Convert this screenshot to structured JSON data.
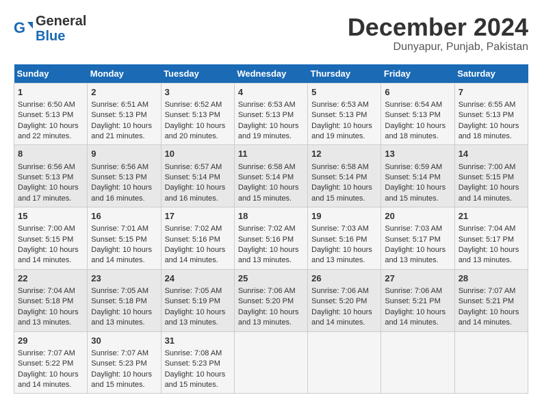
{
  "header": {
    "logo_line1": "General",
    "logo_line2": "Blue",
    "month": "December 2024",
    "location": "Dunyapur, Punjab, Pakistan"
  },
  "days_of_week": [
    "Sunday",
    "Monday",
    "Tuesday",
    "Wednesday",
    "Thursday",
    "Friday",
    "Saturday"
  ],
  "weeks": [
    [
      {
        "day": 1,
        "sunrise": "6:50 AM",
        "sunset": "5:13 PM",
        "daylight": "10 hours and 22 minutes."
      },
      {
        "day": 2,
        "sunrise": "6:51 AM",
        "sunset": "5:13 PM",
        "daylight": "10 hours and 21 minutes."
      },
      {
        "day": 3,
        "sunrise": "6:52 AM",
        "sunset": "5:13 PM",
        "daylight": "10 hours and 20 minutes."
      },
      {
        "day": 4,
        "sunrise": "6:53 AM",
        "sunset": "5:13 PM",
        "daylight": "10 hours and 19 minutes."
      },
      {
        "day": 5,
        "sunrise": "6:53 AM",
        "sunset": "5:13 PM",
        "daylight": "10 hours and 19 minutes."
      },
      {
        "day": 6,
        "sunrise": "6:54 AM",
        "sunset": "5:13 PM",
        "daylight": "10 hours and 18 minutes."
      },
      {
        "day": 7,
        "sunrise": "6:55 AM",
        "sunset": "5:13 PM",
        "daylight": "10 hours and 18 minutes."
      }
    ],
    [
      {
        "day": 8,
        "sunrise": "6:56 AM",
        "sunset": "5:13 PM",
        "daylight": "10 hours and 17 minutes."
      },
      {
        "day": 9,
        "sunrise": "6:56 AM",
        "sunset": "5:13 PM",
        "daylight": "10 hours and 16 minutes."
      },
      {
        "day": 10,
        "sunrise": "6:57 AM",
        "sunset": "5:14 PM",
        "daylight": "10 hours and 16 minutes."
      },
      {
        "day": 11,
        "sunrise": "6:58 AM",
        "sunset": "5:14 PM",
        "daylight": "10 hours and 15 minutes."
      },
      {
        "day": 12,
        "sunrise": "6:58 AM",
        "sunset": "5:14 PM",
        "daylight": "10 hours and 15 minutes."
      },
      {
        "day": 13,
        "sunrise": "6:59 AM",
        "sunset": "5:14 PM",
        "daylight": "10 hours and 15 minutes."
      },
      {
        "day": 14,
        "sunrise": "7:00 AM",
        "sunset": "5:15 PM",
        "daylight": "10 hours and 14 minutes."
      }
    ],
    [
      {
        "day": 15,
        "sunrise": "7:00 AM",
        "sunset": "5:15 PM",
        "daylight": "10 hours and 14 minutes."
      },
      {
        "day": 16,
        "sunrise": "7:01 AM",
        "sunset": "5:15 PM",
        "daylight": "10 hours and 14 minutes."
      },
      {
        "day": 17,
        "sunrise": "7:02 AM",
        "sunset": "5:16 PM",
        "daylight": "10 hours and 14 minutes."
      },
      {
        "day": 18,
        "sunrise": "7:02 AM",
        "sunset": "5:16 PM",
        "daylight": "10 hours and 13 minutes."
      },
      {
        "day": 19,
        "sunrise": "7:03 AM",
        "sunset": "5:16 PM",
        "daylight": "10 hours and 13 minutes."
      },
      {
        "day": 20,
        "sunrise": "7:03 AM",
        "sunset": "5:17 PM",
        "daylight": "10 hours and 13 minutes."
      },
      {
        "day": 21,
        "sunrise": "7:04 AM",
        "sunset": "5:17 PM",
        "daylight": "10 hours and 13 minutes."
      }
    ],
    [
      {
        "day": 22,
        "sunrise": "7:04 AM",
        "sunset": "5:18 PM",
        "daylight": "10 hours and 13 minutes."
      },
      {
        "day": 23,
        "sunrise": "7:05 AM",
        "sunset": "5:18 PM",
        "daylight": "10 hours and 13 minutes."
      },
      {
        "day": 24,
        "sunrise": "7:05 AM",
        "sunset": "5:19 PM",
        "daylight": "10 hours and 13 minutes."
      },
      {
        "day": 25,
        "sunrise": "7:06 AM",
        "sunset": "5:20 PM",
        "daylight": "10 hours and 13 minutes."
      },
      {
        "day": 26,
        "sunrise": "7:06 AM",
        "sunset": "5:20 PM",
        "daylight": "10 hours and 14 minutes."
      },
      {
        "day": 27,
        "sunrise": "7:06 AM",
        "sunset": "5:21 PM",
        "daylight": "10 hours and 14 minutes."
      },
      {
        "day": 28,
        "sunrise": "7:07 AM",
        "sunset": "5:21 PM",
        "daylight": "10 hours and 14 minutes."
      }
    ],
    [
      {
        "day": 29,
        "sunrise": "7:07 AM",
        "sunset": "5:22 PM",
        "daylight": "10 hours and 14 minutes."
      },
      {
        "day": 30,
        "sunrise": "7:07 AM",
        "sunset": "5:23 PM",
        "daylight": "10 hours and 15 minutes."
      },
      {
        "day": 31,
        "sunrise": "7:08 AM",
        "sunset": "5:23 PM",
        "daylight": "10 hours and 15 minutes."
      },
      null,
      null,
      null,
      null
    ]
  ]
}
